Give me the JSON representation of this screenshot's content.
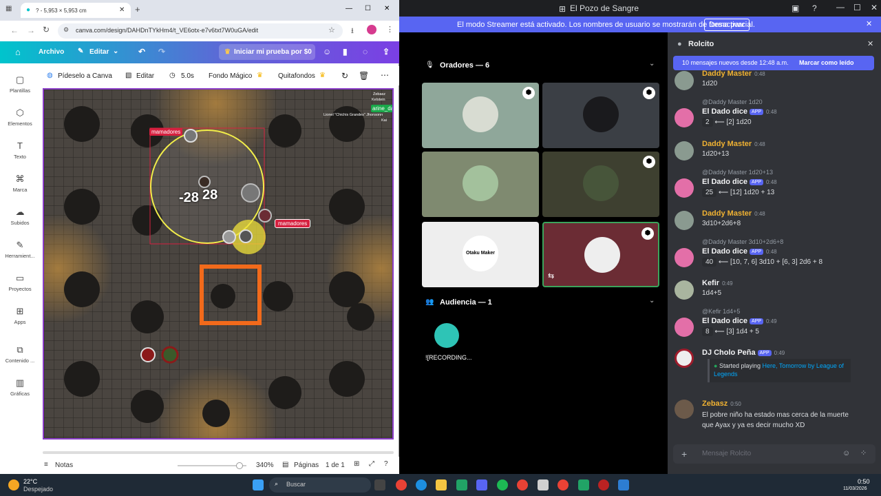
{
  "browser": {
    "tab_title": "? - 5,953 × 5,953 cm",
    "url": "canva.com/design/DAHDnTYkHm4/t_VE6otx-e7v6txt7W0uGA/edit"
  },
  "canva": {
    "menu": {
      "file": "Archivo",
      "edit": "Editar",
      "trial": "Iniciar mi prueba por $0"
    },
    "context": {
      "ask": "Pídeselo a Canva",
      "edit": "Editar",
      "duration": "5.0s",
      "magic": "Fondo Mágico",
      "remove_bg": "Quitafondos"
    },
    "rail": [
      "Plantillas",
      "Elementos",
      "Texto",
      "Marca",
      "Subidos",
      "Herramient...",
      "Proyectos",
      "Apps",
      "Contenido ...",
      "Gráficas"
    ],
    "map": {
      "label_top": "mamadores",
      "label_right": "mamadores",
      "measure": "28",
      "measure2": "-28",
      "names": [
        "Zebasz",
        "Kelstein",
        "arine_dasi",
        "Lionel \"Chichis Grandes\" Jhonsonn",
        "Kai"
      ]
    },
    "bottom": {
      "notes": "Notas",
      "zoom": "340%",
      "pages": "Páginas",
      "page_count": "1 de 1"
    }
  },
  "discord": {
    "window_title": "El Pozo de Sangre",
    "streamer_notice": "El modo Streamer está activado. Los nombres de usuario se mostrarán de forma parcial.",
    "streamer_button": "Desactivar",
    "speakers_label": "Oradores — 6",
    "audience_label": "Audiencia — 1",
    "audience_user": "![RECORDING...",
    "otaku_tile": "Otaku Maker",
    "chat": {
      "channel": "Rolcito",
      "new_banner": "10 mensajes nuevos desde 12:48 a.m.",
      "mark_read": "Marcar como leído",
      "input_placeholder": "Mensaje Rolcito",
      "messages": [
        {
          "user": "Daddy Master",
          "time": "0:48",
          "text": "1d20"
        },
        {
          "reply": "@Daddy Master 1d20",
          "user": "El Dado dice",
          "app": "APP",
          "time": "0:48",
          "result": "2",
          "text": "⟵ [2] 1d20"
        },
        {
          "user": "Daddy Master",
          "time": "0:48",
          "text": "1d20+13"
        },
        {
          "reply": "@Daddy Master 1d20+13",
          "user": "El Dado dice",
          "app": "APP",
          "time": "0:48",
          "result": "25",
          "text": "⟵ [12] 1d20 + 13"
        },
        {
          "user": "Daddy Master",
          "time": "0:48",
          "text": "3d10+2d6+8"
        },
        {
          "reply": "@Daddy Master 3d10+2d6+8",
          "user": "El Dado dice",
          "app": "APP",
          "time": "0:48",
          "result": "40",
          "text": "⟵ [10, 7, 6] 3d10 + [6, 3] 2d6 + 8"
        },
        {
          "user": "Kefir",
          "time": "0:49",
          "text": "1d4+5"
        },
        {
          "reply": "@Kefir 1d4+5",
          "user": "El Dado dice",
          "app": "APP",
          "time": "0:49",
          "result": "8",
          "text": "⟵ [3] 1d4 + 5"
        },
        {
          "user": "DJ Cholo Peña",
          "app": "APP",
          "time": "0:49",
          "text": "Started playing",
          "link": "Here, Tomorrow by League of Legends"
        },
        {
          "user": "Zebasz",
          "time": "0:50",
          "text": "El pobre niño ha estado mas cerca de la muerte que Ayax y ya es decir mucho XD"
        }
      ]
    }
  },
  "taskbar": {
    "weather_temp": "22°C",
    "weather_desc": "Despejado",
    "search": "Buscar",
    "time": "0:50",
    "date": "11/03/2026"
  },
  "colors": {
    "discord_blurple": "#5865f2",
    "canva_gradient_start": "#00c4cc",
    "canva_gradient_end": "#7b3fe4",
    "map_red_label": "#d6203f",
    "orange_square": "#f26a1b"
  }
}
